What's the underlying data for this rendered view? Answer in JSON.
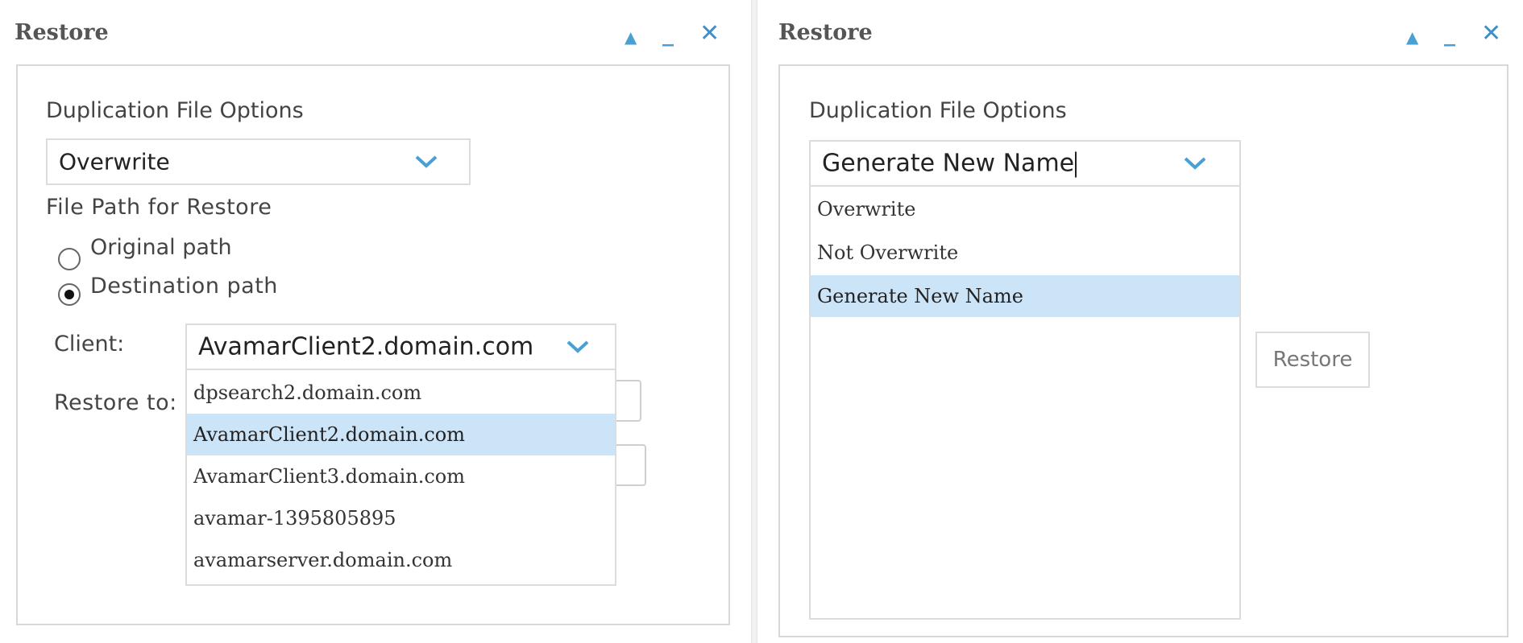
{
  "left_panel": {
    "title": "Restore",
    "duplication_label": "Duplication File Options",
    "duplication_value": "Overwrite",
    "file_path_label": "File Path for Restore",
    "radio_original": "Original path",
    "radio_destination": "Destination path",
    "client_label": "Client:",
    "client_value": "AvamarClient2.domain.com",
    "restore_to_label": "Restore to:",
    "client_options": [
      "dpsearch2.domain.com",
      "AvamarClient2.domain.com",
      "AvamarClient3.domain.com",
      "avamar-1395805895",
      "avamarserver.domain.com"
    ],
    "selected_client_index": 1,
    "selected_radio": "destination"
  },
  "right_panel": {
    "title": "Restore",
    "duplication_label": "Duplication File Options",
    "duplication_value": "Generate New Name",
    "duplication_options": [
      "Overwrite",
      "Not Overwrite",
      "Generate New Name"
    ],
    "selected_option_index": 2,
    "restore_button": "Restore"
  },
  "icons": {
    "collapse": "triangle-up-icon",
    "minimize": "minimize-icon",
    "close": "close-x-icon",
    "chevron": "chevron-down-icon"
  },
  "colors": {
    "accent": "#4a9fd3",
    "selected_bg": "#cce4f8",
    "border": "#dcdcdc"
  }
}
